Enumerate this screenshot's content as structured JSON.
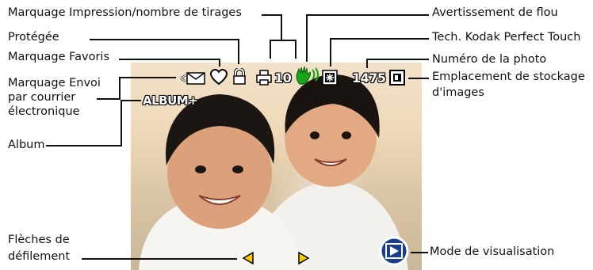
{
  "labels": {
    "print_tag": "Marquage Impression/nombre de tirages",
    "protected": "Protégée",
    "favorites": "Marquage Favoris",
    "email_line1": "Marquage Envoi",
    "email_line2": "par courrier",
    "email_line3": "électronique",
    "album": "Album",
    "scroll_line1": "Flèches de",
    "scroll_line2": "défilement",
    "blur_warning": "Avertissement de flou",
    "perfect_touch": "Tech. Kodak Perfect Touch",
    "picture_number": "Numéro de la photo",
    "storage_line1": "Emplacement de stockage",
    "storage_line2": "d'images",
    "review_mode": "Mode de visualisation"
  },
  "hud": {
    "album_text": "ALBUM+",
    "print_count": "10",
    "picture_number": "1475"
  },
  "icons": [
    "email-icon",
    "heart-icon",
    "lock-icon",
    "print-icon",
    "blur-warning-hand-icon",
    "perfect-touch-icon",
    "storage-card-icon",
    "scroll-left-arrow-icon",
    "scroll-right-arrow-icon",
    "review-mode-play-icon"
  ],
  "colors": {
    "arrow_yellow": "#ffcc00",
    "blur_green": "#1aa81a",
    "review_button": "#1a3d8c"
  }
}
